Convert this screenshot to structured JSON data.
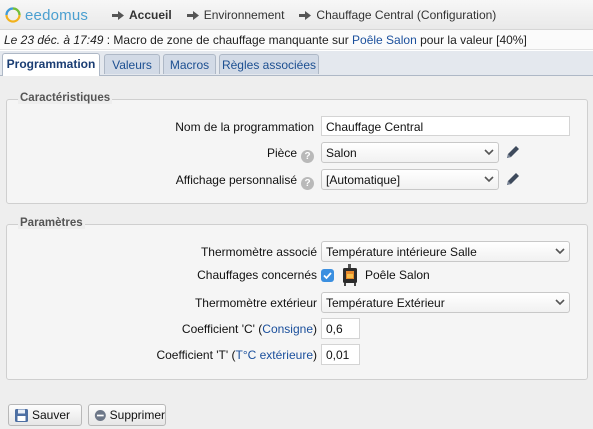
{
  "app": {
    "logo_text": "eedomus"
  },
  "breadcrumb": [
    {
      "label": "Accueil",
      "bold": true
    },
    {
      "label": "Environnement",
      "bold": false
    },
    {
      "label": "Chauffage Central (Configuration)",
      "bold": false
    }
  ],
  "notification": {
    "date": "Le 23 déc. à 17:49",
    "message": " : Macro de zone de chauffage manquante sur ",
    "link": "Poêle Salon",
    "suffix": " pour la valeur [40%]"
  },
  "tabs": [
    "Programmation",
    "Valeurs",
    "Macros",
    "Règles associées"
  ],
  "active_tab": "Programmation",
  "sections": {
    "caracteristiques": {
      "legend": "Caractéristiques",
      "name_label": "Nom de la programmation",
      "name_value": "Chauffage Central",
      "piece_label": "Pièce",
      "piece_value": "Salon",
      "affichage_label": "Affichage personnalisé",
      "affichage_value": "[Automatique]"
    },
    "parametres": {
      "legend": "Paramètres",
      "thermo_assoc_label": "Thermomètre associé",
      "thermo_assoc_value": "Température intérieure Salle",
      "chauffages_label": "Chauffages concernés",
      "chauffage_item": "Poêle Salon",
      "chauffage_checked": true,
      "thermo_ext_label": "Thermomètre extérieur",
      "thermo_ext_value": "Température Extérieur",
      "coef_c_prefix": "Coefficient 'C' (",
      "coef_c_link": "Consigne",
      "coef_c_suffix": ")",
      "coef_c_value": "0,6",
      "coef_t_prefix": "Coefficient 'T' (",
      "coef_t_link": "T°C extérieure",
      "coef_t_suffix": ")",
      "coef_t_value": "0,01"
    }
  },
  "buttons": {
    "save": "Sauver",
    "delete": "Supprimer"
  },
  "colors": {
    "link": "#1a4f9c",
    "tab_bg": "#d2dae6",
    "checkbox": "#3b8fe0",
    "logo": "#4a9fd0"
  },
  "icons": [
    "eedomus-logo-icon",
    "breadcrumb-arrow-icon",
    "help-icon",
    "chevron-down-icon",
    "pencil-icon",
    "stove-icon",
    "save-icon",
    "delete-icon"
  ]
}
